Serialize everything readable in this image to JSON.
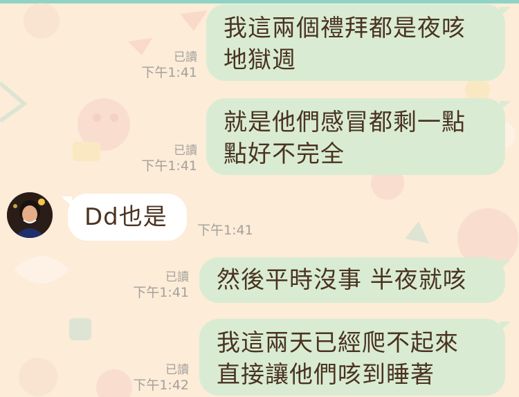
{
  "chat": {
    "messages": [
      {
        "direction": "outgoing",
        "lines": [
          "我這兩個禮拜都是夜咳",
          "地獄週"
        ],
        "read_label": "已讀",
        "time": "下午1:41"
      },
      {
        "direction": "outgoing",
        "lines": [
          "就是他們感冒都剩一點",
          "點好不完全"
        ],
        "read_label": "已讀",
        "time": "下午1:41"
      },
      {
        "direction": "incoming",
        "lines": [
          "Dd也是"
        ],
        "time": "下午1:41",
        "avatar_icon": "contact-avatar"
      },
      {
        "direction": "outgoing",
        "lines": [
          "然後平時沒事 半夜就咳"
        ],
        "read_label": "已讀",
        "time": "下午1:41"
      },
      {
        "direction": "outgoing",
        "lines": [
          "我這兩天已經爬不起來",
          "直接讓他們咳到睡著"
        ],
        "read_label": "已讀",
        "time": "下午1:42"
      }
    ]
  },
  "colors": {
    "background": "#fcecd8",
    "outgoing_bubble": "#d9ecd3",
    "incoming_bubble": "#ffffff",
    "text": "#4a3320",
    "meta_text": "#a4a09a",
    "top_strip": "#8fd3c4"
  }
}
